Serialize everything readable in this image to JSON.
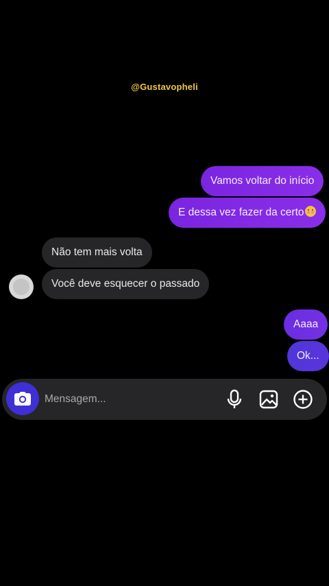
{
  "watermark": "@Gustavopheli",
  "messages": [
    {
      "side": "sent",
      "text": "Vamos voltar do início"
    },
    {
      "side": "sent",
      "text": "E dessa vez fazer da certo"
    },
    {
      "side": "received",
      "text": "Não tem mais volta"
    },
    {
      "side": "received",
      "text": "Você deve esquecer o passado"
    },
    {
      "side": "sent",
      "text": "Aaaa"
    },
    {
      "side": "sent",
      "text": "Ok..."
    }
  ],
  "emoji_icon": "blushing-face-emoji",
  "composer": {
    "placeholder": "Mensagem...",
    "icons": [
      "camera-icon",
      "microphone-icon",
      "gallery-icon",
      "plus-circle-icon"
    ]
  },
  "colors": {
    "sent_bubble": "#8a2ee8",
    "received_bubble": "#262628",
    "camera_button": "#3f2fd6",
    "watermark": "#f2c744"
  }
}
